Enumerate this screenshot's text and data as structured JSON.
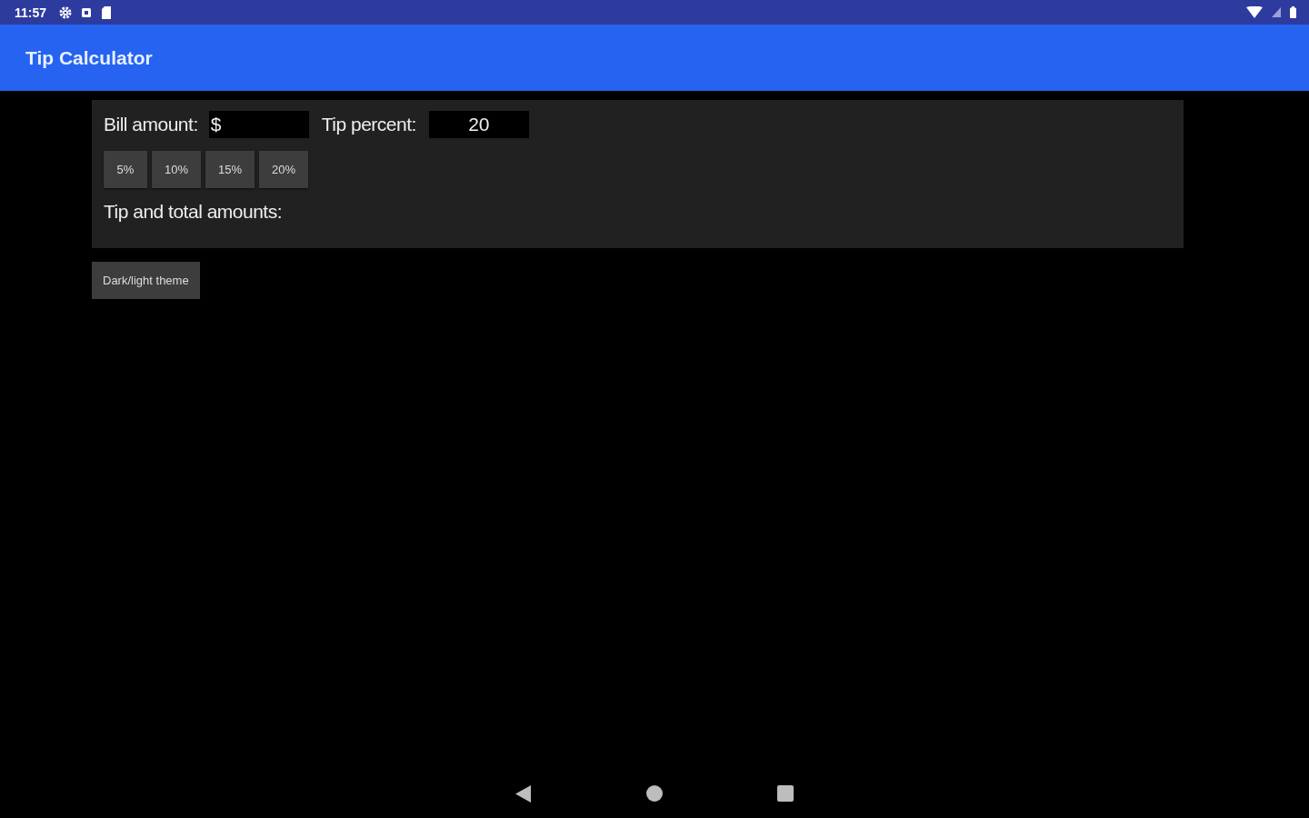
{
  "status_bar": {
    "time": "11:57"
  },
  "app_bar": {
    "title": "Tip Calculator"
  },
  "form": {
    "bill_label": "Bill amount:",
    "currency": "$",
    "tip_label": "Tip percent:",
    "tip_value": "20",
    "presets": [
      "5%",
      "10%",
      "15%",
      "20%"
    ],
    "result_label": "Tip and total amounts:"
  },
  "theme_button": "Dark/light theme"
}
